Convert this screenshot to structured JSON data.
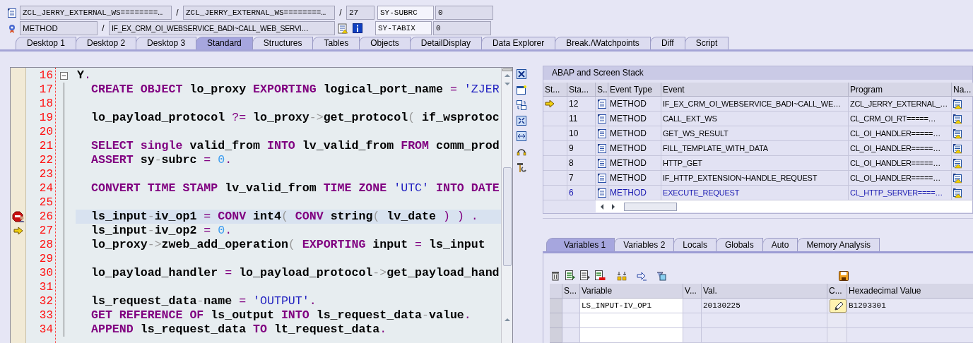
{
  "location": {
    "program": "ZCL_JERRY_EXTERNAL_WS========…",
    "include": "ZCL_JERRY_EXTERNAL_WS========…",
    "line": "27",
    "event_type": "METHOD",
    "event": "IF_EX_CRM_OI_WEBSERVICE_BADI~CALL_WEB_SERVI…",
    "separators": [
      "/",
      "/",
      "/"
    ]
  },
  "system_fields": [
    {
      "name": "SY-SUBRC",
      "value": "0"
    },
    {
      "name": "SY-TABIX",
      "value": "0"
    }
  ],
  "desktop_tabs": [
    {
      "label": "Desktop 1",
      "selected": false
    },
    {
      "label": "Desktop 2",
      "selected": false
    },
    {
      "label": "Desktop 3",
      "selected": false
    },
    {
      "label": "Standard",
      "selected": true
    },
    {
      "label": "Structures",
      "selected": false
    },
    {
      "label": "Tables",
      "selected": false
    },
    {
      "label": "Objects",
      "selected": false
    },
    {
      "label": "DetailDisplay",
      "selected": false
    },
    {
      "label": "Data Explorer",
      "selected": false
    },
    {
      "label": "Break./Watchpoints",
      "selected": false
    },
    {
      "label": "Diff",
      "selected": false
    },
    {
      "label": "Script",
      "selected": false
    }
  ],
  "source": {
    "lines": [
      {
        "number": "16",
        "breakpoint": false,
        "current": false,
        "selected": false,
        "expanded": true,
        "segments": [
          {
            "text": "Y",
            "kind": "id"
          },
          {
            "text": ".",
            "kind": "op"
          }
        ],
        "children": [
          {
            "number": "17",
            "breakpoint": false,
            "current": false,
            "selected": false,
            "segments": [
              {
                "text": "CREATE OBJECT ",
                "kind": "kw"
              },
              {
                "text": "lo_proxy ",
                "kind": "id"
              },
              {
                "text": "EXPORTING ",
                "kind": "kw"
              },
              {
                "text": "logical_port_name ",
                "kind": "id"
              },
              {
                "text": "= ",
                "kind": "op"
              },
              {
                "text": "'ZJER",
                "kind": "str"
              }
            ]
          },
          {
            "number": "18",
            "breakpoint": false,
            "current": false,
            "selected": false
          },
          {
            "number": "19",
            "breakpoint": false,
            "current": false,
            "selected": false,
            "segments": [
              {
                "text": "lo_payload_protocol ",
                "kind": "id"
              },
              {
                "text": "?= ",
                "kind": "op"
              },
              {
                "text": "lo_proxy",
                "kind": "id"
              },
              {
                "text": "->",
                "kind": "sym"
              },
              {
                "text": "get_protocol",
                "kind": "id"
              },
              {
                "text": "( ",
                "kind": "sym"
              },
              {
                "text": "if_wsprotoc",
                "kind": "id"
              }
            ]
          },
          {
            "number": "20",
            "breakpoint": false,
            "current": false,
            "selected": false
          },
          {
            "number": "21",
            "breakpoint": false,
            "current": false,
            "selected": false,
            "segments": [
              {
                "text": "SELECT single ",
                "kind": "kw"
              },
              {
                "text": "valid_from ",
                "kind": "id"
              },
              {
                "text": "INTO ",
                "kind": "kw"
              },
              {
                "text": "lv_valid_from ",
                "kind": "id"
              },
              {
                "text": "FROM ",
                "kind": "kw"
              },
              {
                "text": "comm_prod",
                "kind": "id"
              }
            ]
          },
          {
            "number": "22",
            "breakpoint": false,
            "current": false,
            "selected": false,
            "segments": [
              {
                "text": "ASSERT ",
                "kind": "kw"
              },
              {
                "text": "sy",
                "kind": "id"
              },
              {
                "text": "-",
                "kind": "sym"
              },
              {
                "text": "subrc ",
                "kind": "id"
              },
              {
                "text": "= ",
                "kind": "op"
              },
              {
                "text": "0",
                "kind": "num"
              },
              {
                "text": ".",
                "kind": "op"
              }
            ]
          },
          {
            "number": "23",
            "breakpoint": false,
            "current": false,
            "selected": false
          },
          {
            "number": "24",
            "breakpoint": false,
            "current": false,
            "selected": false,
            "segments": [
              {
                "text": "CONVERT TIME STAMP ",
                "kind": "kw"
              },
              {
                "text": "lv_valid_from ",
                "kind": "id"
              },
              {
                "text": "TIME ZONE ",
                "kind": "kw"
              },
              {
                "text": "'UTC' ",
                "kind": "str"
              },
              {
                "text": "INTO DATE",
                "kind": "kw"
              }
            ]
          },
          {
            "number": "25",
            "breakpoint": false,
            "current": false,
            "selected": false
          },
          {
            "number": "26",
            "breakpoint": true,
            "current": false,
            "selected": true,
            "segments": [
              {
                "text": "ls_input",
                "kind": "id"
              },
              {
                "text": "-",
                "kind": "sym"
              },
              {
                "text": "iv_op1 ",
                "kind": "id"
              },
              {
                "text": "= ",
                "kind": "op"
              },
              {
                "text": "CONV ",
                "kind": "kw"
              },
              {
                "text": "int4",
                "kind": "id"
              },
              {
                "text": "( ",
                "kind": "sym"
              },
              {
                "text": "CONV ",
                "kind": "kw"
              },
              {
                "text": "string",
                "kind": "id"
              },
              {
                "text": "( ",
                "kind": "sym"
              },
              {
                "text": "lv_date ",
                "kind": "id"
              },
              {
                "text": ") ) ",
                "kind": "op"
              },
              {
                "text": ".",
                "kind": "op"
              }
            ]
          },
          {
            "number": "27",
            "breakpoint": false,
            "current": true,
            "selected": false,
            "segments": [
              {
                "text": "ls_input",
                "kind": "id"
              },
              {
                "text": "-",
                "kind": "sym"
              },
              {
                "text": "iv_op2 ",
                "kind": "id"
              },
              {
                "text": "= ",
                "kind": "op"
              },
              {
                "text": "0",
                "kind": "num"
              },
              {
                "text": ".",
                "kind": "op"
              }
            ]
          },
          {
            "number": "28",
            "breakpoint": false,
            "current": false,
            "selected": false,
            "segments": [
              {
                "text": "lo_proxy",
                "kind": "id"
              },
              {
                "text": "->",
                "kind": "sym"
              },
              {
                "text": "zweb_add_operation",
                "kind": "id"
              },
              {
                "text": "( ",
                "kind": "sym"
              },
              {
                "text": "EXPORTING ",
                "kind": "kw"
              },
              {
                "text": "input ",
                "kind": "id"
              },
              {
                "text": "= ",
                "kind": "op"
              },
              {
                "text": "ls_input",
                "kind": "id"
              }
            ]
          },
          {
            "number": "29",
            "breakpoint": false,
            "current": false,
            "selected": false
          },
          {
            "number": "30",
            "breakpoint": false,
            "current": false,
            "selected": false,
            "segments": [
              {
                "text": "lo_payload_handler ",
                "kind": "id"
              },
              {
                "text": "= ",
                "kind": "op"
              },
              {
                "text": "lo_payload_protocol",
                "kind": "id"
              },
              {
                "text": "->",
                "kind": "sym"
              },
              {
                "text": "get_payload_hand",
                "kind": "id"
              }
            ]
          },
          {
            "number": "31",
            "breakpoint": false,
            "current": false,
            "selected": false
          },
          {
            "number": "32",
            "breakpoint": false,
            "current": false,
            "selected": false,
            "segments": [
              {
                "text": "ls_request_data",
                "kind": "id"
              },
              {
                "text": "-",
                "kind": "sym"
              },
              {
                "text": "name ",
                "kind": "id"
              },
              {
                "text": "= ",
                "kind": "op"
              },
              {
                "text": "'OUTPUT'",
                "kind": "str"
              },
              {
                "text": ".",
                "kind": "op"
              }
            ]
          },
          {
            "number": "33",
            "breakpoint": false,
            "current": false,
            "selected": false,
            "segments": [
              {
                "text": "GET REFERENCE OF ",
                "kind": "kw"
              },
              {
                "text": "ls_output ",
                "kind": "id"
              },
              {
                "text": "INTO ",
                "kind": "kw"
              },
              {
                "text": "ls_request_data",
                "kind": "id"
              },
              {
                "text": "-",
                "kind": "sym"
              },
              {
                "text": "value",
                "kind": "id"
              },
              {
                "text": ".",
                "kind": "op"
              }
            ]
          },
          {
            "number": "34",
            "breakpoint": false,
            "current": false,
            "selected": false,
            "segments": [
              {
                "text": "APPEND ",
                "kind": "kw"
              },
              {
                "text": "ls_request_data ",
                "kind": "id"
              },
              {
                "text": "TO ",
                "kind": "kw"
              },
              {
                "text": "lt_request_data",
                "kind": "id"
              },
              {
                "text": ".",
                "kind": "op"
              }
            ]
          }
        ]
      }
    ]
  },
  "stack": {
    "title": "ABAP and Screen Stack",
    "columns": [
      "St...",
      "Sta...",
      "S..",
      "Event Type",
      "Event",
      "Program",
      "Na..."
    ],
    "rows": [
      {
        "number": "12",
        "event_type": "METHOD",
        "event": "IF_EX_CRM_OI_WEBSERVICE_BADI~CALL_WE…",
        "program": "ZCL_JERRY_EXTERNAL_…",
        "current": true,
        "active": false
      },
      {
        "number": "11",
        "event_type": "METHOD",
        "event": "CALL_EXT_WS",
        "program": "CL_CRM_OI_RT=====…",
        "current": false,
        "active": false
      },
      {
        "number": "10",
        "event_type": "METHOD",
        "event": "GET_WS_RESULT",
        "program": "CL_OI_HANDLER=====…",
        "current": false,
        "active": false
      },
      {
        "number": "9",
        "event_type": "METHOD",
        "event": "FILL_TEMPLATE_WITH_DATA",
        "program": "CL_OI_HANDLER=====…",
        "current": false,
        "active": false
      },
      {
        "number": "8",
        "event_type": "METHOD",
        "event": "HTTP_GET",
        "program": "CL_OI_HANDLER=====…",
        "current": false,
        "active": false
      },
      {
        "number": "7",
        "event_type": "METHOD",
        "event": "IF_HTTP_EXTENSION~HANDLE_REQUEST",
        "program": "CL_OI_HANDLER=====…",
        "current": false,
        "active": false
      },
      {
        "number": "6",
        "event_type": "METHOD",
        "event": "EXECUTE_REQUEST",
        "program": "CL_HTTP_SERVER====…",
        "current": false,
        "active": true
      }
    ]
  },
  "variable_tabs": [
    {
      "label": "Variables 1",
      "selected": true
    },
    {
      "label": "Variables 2",
      "selected": false
    },
    {
      "label": "Locals",
      "selected": false
    },
    {
      "label": "Globals",
      "selected": false
    },
    {
      "label": "Auto",
      "selected": false
    },
    {
      "label": "Memory Analysis",
      "selected": false
    }
  ],
  "variables": {
    "columns": [
      "S...",
      "Variable",
      "V...",
      "Val.",
      "C...",
      "Hexadecimal Value"
    ],
    "rows": [
      {
        "variable": "LS_INPUT-IV_OP1",
        "value": "20130225",
        "hex": "B1293301"
      }
    ]
  }
}
